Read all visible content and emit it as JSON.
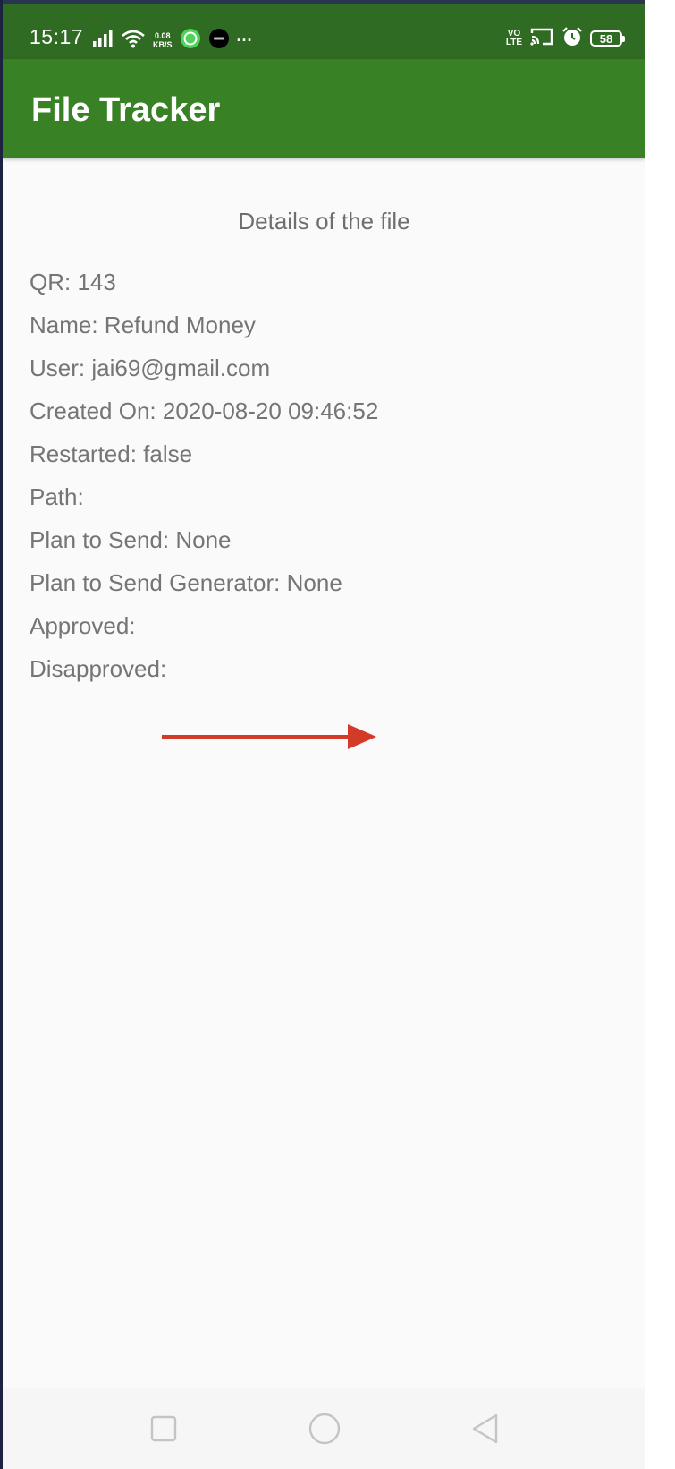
{
  "status_bar": {
    "time": "15:17",
    "net_speed_value": "0.08",
    "net_speed_unit": "KB/S",
    "more_indicator": "···",
    "volte_top": "VO",
    "volte_bottom": "LTE",
    "battery_level": "58",
    "icons": [
      "signal-icon",
      "wifi-icon",
      "whatsapp-icon",
      "uber-icon",
      "cast-icon",
      "alarm-icon",
      "battery-icon"
    ]
  },
  "app_bar": {
    "title": "File Tracker",
    "color": "#398125"
  },
  "details": {
    "heading": "Details of the file",
    "fields": [
      "QR: 143",
      "Name: Refund Money",
      "User: jai69@gmail.com",
      "Created On: 2020-08-20 09:46:52",
      "Restarted: false",
      "Path:",
      "Plan to Send: None",
      "Plan to Send Generator: None",
      "Approved:",
      "Disapproved:"
    ]
  },
  "annotation": {
    "icon": "arrow-right-icon",
    "color": "#d13b27"
  },
  "nav_bar": {
    "icons": [
      "recents-square-icon",
      "home-circle-icon",
      "back-triangle-icon"
    ]
  }
}
